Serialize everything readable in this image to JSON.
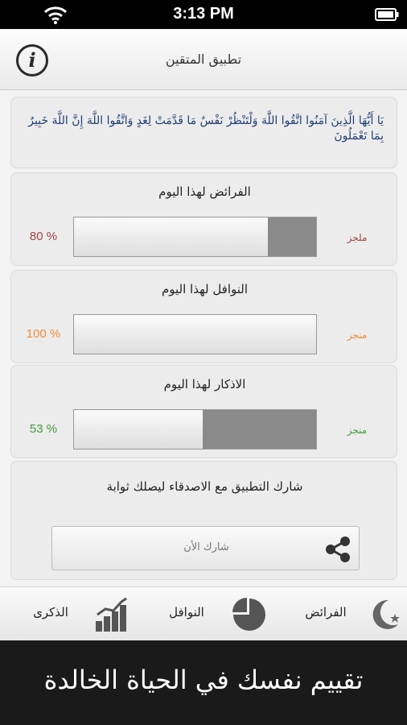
{
  "status_bar": {
    "time": "3:13 PM"
  },
  "header": {
    "title": "تطبيق المتقين",
    "info_icon": "info-icon"
  },
  "verse": {
    "text": "يَا أَيُّهَا الَّذِينَ آمَنُوا اتَّقُوا اللَّهَ وَلْتَنْظُرْ نَفْسٌ مَا قَدَّمَتْ لِغَدٍ وَاتَّقُوا اللَّهَ إِنَّ اللَّهَ خَبِيرٌ بِمَا تَعْمَلُونَ"
  },
  "progress_cards": [
    {
      "title": "الفرائض لهذا اليوم",
      "percent_label": "80 %",
      "done_label": "ملجز",
      "fill_fraction": 0.2,
      "color": "#a34242"
    },
    {
      "title": "النوافل لهذا اليوم",
      "percent_label": "100 %",
      "done_label": "منجز",
      "fill_fraction": 0.0,
      "color": "#f08a3a"
    },
    {
      "title": "الاذكار لهذا اليوم",
      "percent_label": "53 %",
      "done_label": "منجز",
      "fill_fraction": 0.47,
      "color": "#3f9a3f"
    }
  ],
  "share": {
    "text": "شارك التطبيق مع الاصدقاء ليصلك ثوابة",
    "button_label": "شارك الأن",
    "icon": "share-icon"
  },
  "tabs": [
    {
      "label": "الفرائض",
      "icon": "crescent-star-icon"
    },
    {
      "label": "النوافل",
      "icon": "pie-chart-icon"
    },
    {
      "label": "الذكرى",
      "icon": "bar-chart-icon"
    }
  ],
  "caption": "تقييم نفسك في الحياة الخالدة"
}
